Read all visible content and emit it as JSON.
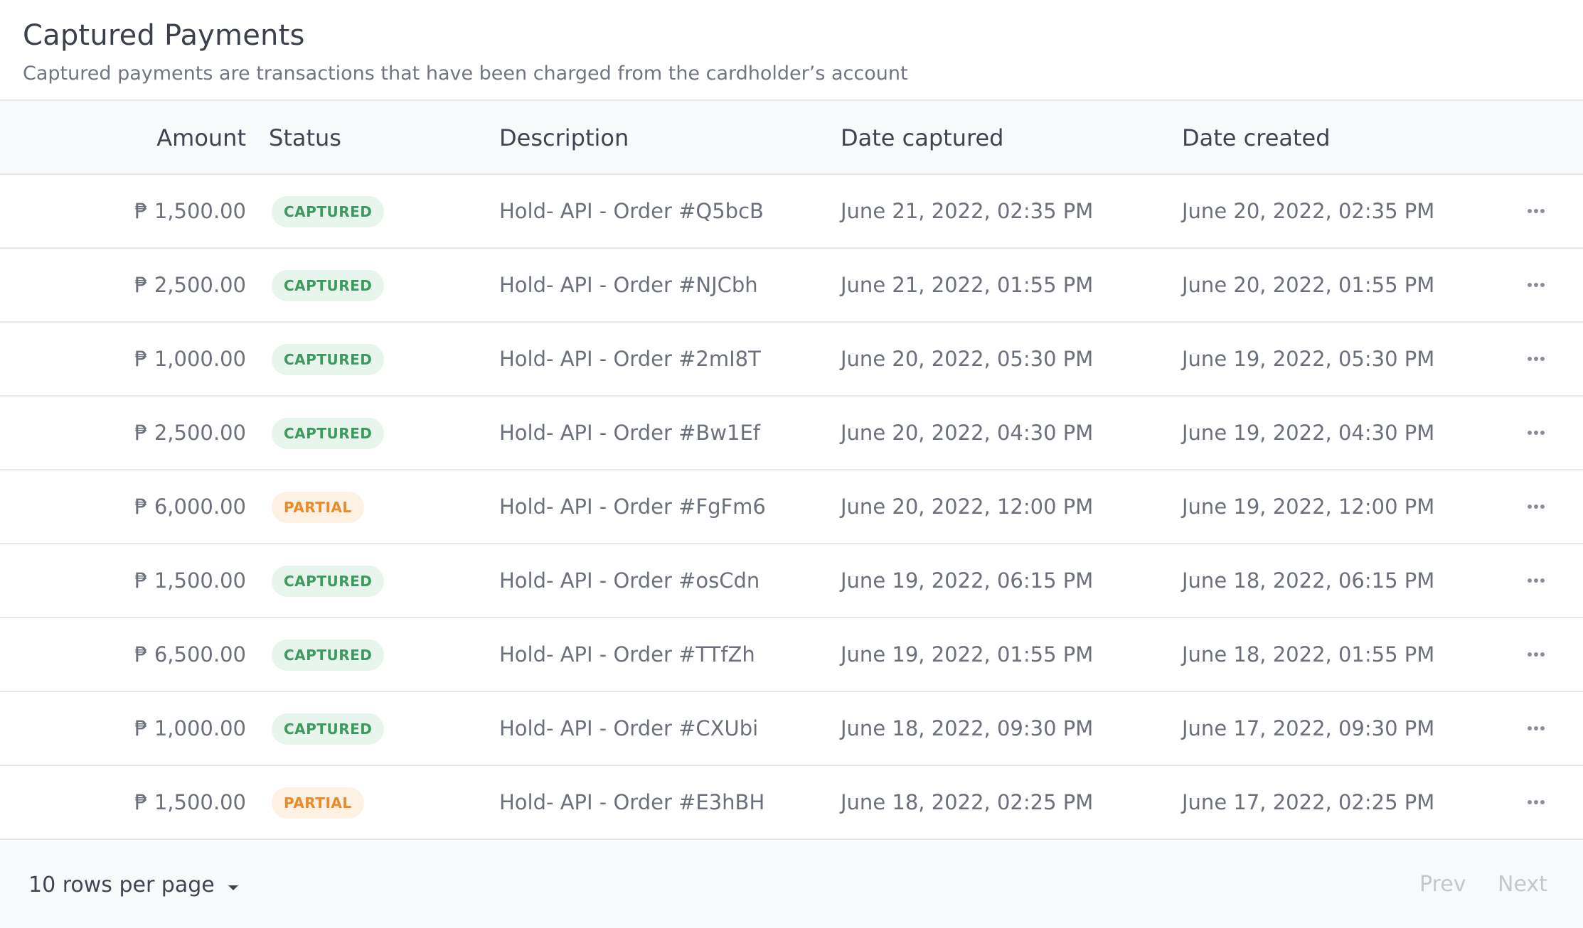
{
  "header": {
    "title": "Captured Payments",
    "subtitle": "Captured payments are transactions that have been charged from the cardholder’s account"
  },
  "table": {
    "columns": {
      "amount": "Amount",
      "status": "Status",
      "description": "Description",
      "date_captured": "Date captured",
      "date_created": "Date created"
    },
    "rows": [
      {
        "amount": "₱ 1,500.00",
        "status": "CAPTURED",
        "status_type": "captured",
        "description": "Hold- API - Order #Q5bcB",
        "date_captured": "June  21, 2022, 02:35 PM",
        "date_created": "June  20, 2022, 02:35 PM"
      },
      {
        "amount": "₱ 2,500.00",
        "status": "CAPTURED",
        "status_type": "captured",
        "description": "Hold- API - Order #NJCbh",
        "date_captured": "June 21, 2022, 01:55 PM",
        "date_created": "June 20, 2022, 01:55 PM"
      },
      {
        "amount": "₱ 1,000.00",
        "status": "CAPTURED",
        "status_type": "captured",
        "description": "Hold- API  - Order #2mI8T",
        "date_captured": "June 20, 2022, 05:30 PM",
        "date_created": "June 19, 2022, 05:30 PM"
      },
      {
        "amount": "₱ 2,500.00",
        "status": "CAPTURED",
        "status_type": "captured",
        "description": "Hold- API - Order #Bw1Ef",
        "date_captured": "June 20, 2022, 04:30 PM",
        "date_created": "June 19, 2022, 04:30 PM"
      },
      {
        "amount": "₱ 6,000.00",
        "status": "PARTIAL",
        "status_type": "partial",
        "description": "Hold- API - Order #FgFm6",
        "date_captured": "June 20, 2022, 12:00 PM",
        "date_created": "June 19, 2022, 12:00 PM"
      },
      {
        "amount": "₱ 1,500.00",
        "status": "CAPTURED",
        "status_type": "captured",
        "description": "Hold- API - Order #osCdn",
        "date_captured": "June 19, 2022, 06:15 PM",
        "date_created": "June 18, 2022, 06:15 PM"
      },
      {
        "amount": "₱ 6,500.00",
        "status": "CAPTURED",
        "status_type": "captured",
        "description": "Hold- API - Order #TTfZh",
        "date_captured": "June 19, 2022, 01:55 PM",
        "date_created": "June 18, 2022, 01:55 PM"
      },
      {
        "amount": "₱ 1,000.00",
        "status": "CAPTURED",
        "status_type": "captured",
        "description": "Hold- API - Order #CXUbi",
        "date_captured": "June 18, 2022, 09:30 PM",
        "date_created": "June 17, 2022, 09:30 PM"
      },
      {
        "amount": "₱ 1,500.00",
        "status": "PARTIAL",
        "status_type": "partial",
        "description": "Hold- API - Order #E3hBH",
        "date_captured": "June 18, 2022, 02:25 PM",
        "date_created": "June 17, 2022, 02:25 PM"
      }
    ]
  },
  "footer": {
    "rows_per_page": "10 rows per page",
    "prev": "Prev",
    "next": "Next"
  },
  "icons": {
    "row_actions": "more-horizontal-icon",
    "rows_dropdown": "caret-down-icon"
  },
  "colors": {
    "captured_bg": "#e8f5ec",
    "captured_text": "#3c9a5f",
    "partial_bg": "#fdf1e4",
    "partial_text": "#ea8a2a"
  }
}
